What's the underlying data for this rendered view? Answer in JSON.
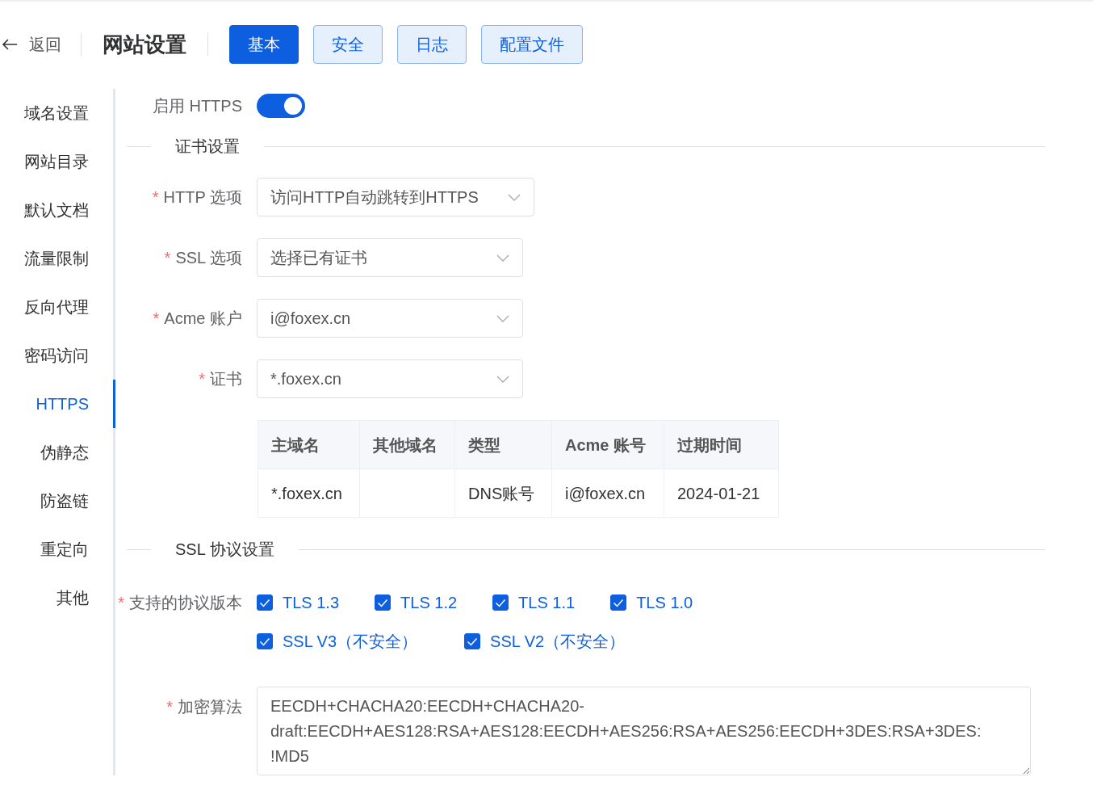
{
  "header": {
    "back": "返回",
    "title": "网站设置",
    "tabs": [
      {
        "label": "基本",
        "selected": true
      },
      {
        "label": "安全",
        "selected": false
      },
      {
        "label": "日志",
        "selected": false
      },
      {
        "label": "配置文件",
        "selected": false
      }
    ]
  },
  "sidebar": {
    "items": [
      {
        "label": "域名设置",
        "selected": false
      },
      {
        "label": "网站目录",
        "selected": false
      },
      {
        "label": "默认文档",
        "selected": false
      },
      {
        "label": "流量限制",
        "selected": false
      },
      {
        "label": "反向代理",
        "selected": false
      },
      {
        "label": "密码访问",
        "selected": false
      },
      {
        "label": "HTTPS",
        "selected": true
      },
      {
        "label": "伪静态",
        "selected": false
      },
      {
        "label": "防盗链",
        "selected": false
      },
      {
        "label": "重定向",
        "selected": false
      },
      {
        "label": "其他",
        "selected": false
      }
    ]
  },
  "https_toggle": {
    "label": "启用 HTTPS",
    "on": true
  },
  "cert_section": {
    "title": "证书设置",
    "fields": [
      {
        "label": "HTTP 选项",
        "required_mark": "*",
        "value": "访问HTTP自动跳转到HTTPS"
      },
      {
        "label": "SSL 选项",
        "required_mark": "*",
        "value": "选择已有证书"
      },
      {
        "label": "Acme 账户",
        "required_mark": "*",
        "value": "i@foxex.cn"
      },
      {
        "label": "证书",
        "required_mark": "*",
        "value": "*.foxex.cn"
      }
    ],
    "table": {
      "columns": [
        "主域名",
        "其他域名",
        "类型",
        "Acme 账号",
        "过期时间"
      ],
      "rows": [
        [
          "*.foxex.cn",
          "",
          "DNS账号",
          "i@foxex.cn",
          "2024-01-21"
        ]
      ]
    }
  },
  "ssl_section": {
    "title": "SSL 协议设置",
    "protocols_label": "支持的协议版本",
    "protocols_required_mark": "*",
    "protocols": [
      [
        {
          "label": "TLS 1.3",
          "checked": true
        },
        {
          "label": "TLS 1.2",
          "checked": true
        },
        {
          "label": "TLS 1.1",
          "checked": true
        },
        {
          "label": "TLS 1.0",
          "checked": true
        }
      ],
      [
        {
          "label": "SSL V3（不安全）",
          "checked": true
        },
        {
          "label": "SSL V2（不安全）",
          "checked": true
        }
      ]
    ],
    "cipher_label": "加密算法",
    "cipher_required_mark": "*",
    "cipher": "EECDH+CHACHA20:EECDH+CHACHA20-draft:EECDH+AES128:RSA+AES128:EECDH+AES256:RSA+AES256:EECDH+3DES:RSA+3DES:!MD5"
  }
}
